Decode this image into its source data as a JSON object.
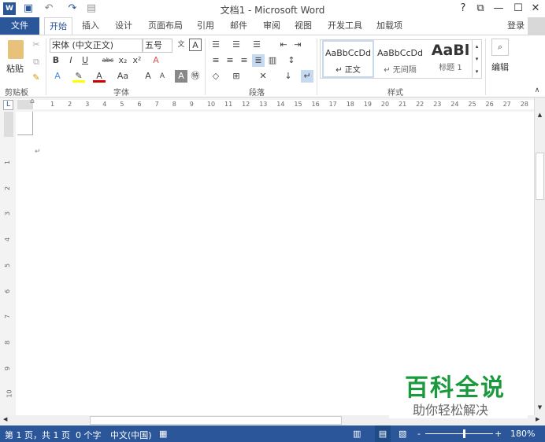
{
  "title": "文档1 - Microsoft Word",
  "window_controls": {
    "help": "?",
    "restore": "⧉",
    "minimize": "—",
    "maximize": "☐",
    "close": "✕"
  },
  "tabs": [
    "文件",
    "开始",
    "插入",
    "设计",
    "页面布局",
    "引用",
    "邮件",
    "审阅",
    "视图",
    "开发工具",
    "加载项"
  ],
  "signin": "登录",
  "clipboard": {
    "paste": "粘贴",
    "group": "剪贴板"
  },
  "font": {
    "name": "宋体 (中文正文)",
    "size": "五号",
    "group": "字体",
    "bold": "B",
    "italic": "I",
    "underline": "U",
    "strike": "abc",
    "sub": "x₂",
    "sup": "x²",
    "aa": "Aa",
    "grow": "A",
    "shrink": "A"
  },
  "paragraph": {
    "group": "段落"
  },
  "styles": {
    "group": "样式",
    "items": [
      {
        "preview": "AaBbCcDd",
        "name": "↵ 正文"
      },
      {
        "preview": "AaBbCcDd",
        "name": "↵ 无间隔"
      },
      {
        "preview": "AaBl",
        "name": "标题 1"
      }
    ]
  },
  "editing": {
    "label": "编辑"
  },
  "ruler": {
    "h": [
      1,
      2,
      3,
      4,
      5,
      6,
      7,
      8,
      9,
      10,
      11,
      12,
      13,
      14,
      15,
      16,
      17,
      18,
      19,
      20,
      21,
      22,
      23,
      24,
      25,
      26,
      27,
      28
    ],
    "v": [
      1,
      2,
      3,
      4,
      5,
      6,
      7,
      8,
      9,
      10
    ],
    "tab_selector": "L"
  },
  "watermark": {
    "title": "百科全说",
    "subtitle": "助你轻松解决",
    "color": "#1a9a3c"
  },
  "status": {
    "page": "第 1 页，共 1 页",
    "words": "0 个字",
    "lang": "中文(中国)",
    "zoom": "180%",
    "zoom_minus": "-",
    "zoom_plus": "+"
  },
  "colors": {
    "accent": "#2b579a"
  }
}
